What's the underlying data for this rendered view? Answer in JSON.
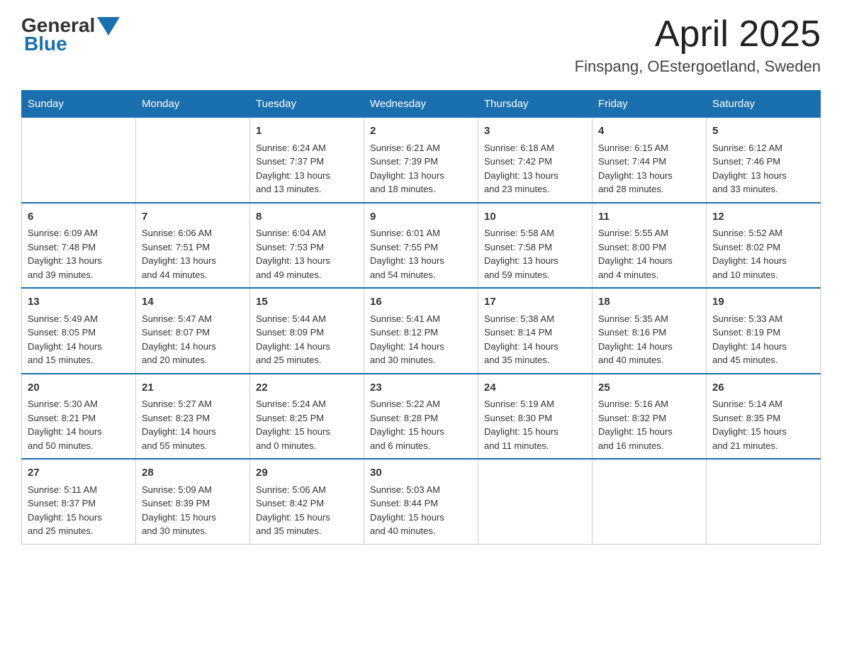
{
  "header": {
    "title": "April 2025",
    "subtitle": "Finspang, OEstergoetland, Sweden",
    "logo_general": "General",
    "logo_blue": "Blue"
  },
  "weekdays": [
    "Sunday",
    "Monday",
    "Tuesday",
    "Wednesday",
    "Thursday",
    "Friday",
    "Saturday"
  ],
  "weeks": [
    [
      {
        "day": "",
        "info": ""
      },
      {
        "day": "",
        "info": ""
      },
      {
        "day": "1",
        "info": "Sunrise: 6:24 AM\nSunset: 7:37 PM\nDaylight: 13 hours\nand 13 minutes."
      },
      {
        "day": "2",
        "info": "Sunrise: 6:21 AM\nSunset: 7:39 PM\nDaylight: 13 hours\nand 18 minutes."
      },
      {
        "day": "3",
        "info": "Sunrise: 6:18 AM\nSunset: 7:42 PM\nDaylight: 13 hours\nand 23 minutes."
      },
      {
        "day": "4",
        "info": "Sunrise: 6:15 AM\nSunset: 7:44 PM\nDaylight: 13 hours\nand 28 minutes."
      },
      {
        "day": "5",
        "info": "Sunrise: 6:12 AM\nSunset: 7:46 PM\nDaylight: 13 hours\nand 33 minutes."
      }
    ],
    [
      {
        "day": "6",
        "info": "Sunrise: 6:09 AM\nSunset: 7:48 PM\nDaylight: 13 hours\nand 39 minutes."
      },
      {
        "day": "7",
        "info": "Sunrise: 6:06 AM\nSunset: 7:51 PM\nDaylight: 13 hours\nand 44 minutes."
      },
      {
        "day": "8",
        "info": "Sunrise: 6:04 AM\nSunset: 7:53 PM\nDaylight: 13 hours\nand 49 minutes."
      },
      {
        "day": "9",
        "info": "Sunrise: 6:01 AM\nSunset: 7:55 PM\nDaylight: 13 hours\nand 54 minutes."
      },
      {
        "day": "10",
        "info": "Sunrise: 5:58 AM\nSunset: 7:58 PM\nDaylight: 13 hours\nand 59 minutes."
      },
      {
        "day": "11",
        "info": "Sunrise: 5:55 AM\nSunset: 8:00 PM\nDaylight: 14 hours\nand 4 minutes."
      },
      {
        "day": "12",
        "info": "Sunrise: 5:52 AM\nSunset: 8:02 PM\nDaylight: 14 hours\nand 10 minutes."
      }
    ],
    [
      {
        "day": "13",
        "info": "Sunrise: 5:49 AM\nSunset: 8:05 PM\nDaylight: 14 hours\nand 15 minutes."
      },
      {
        "day": "14",
        "info": "Sunrise: 5:47 AM\nSunset: 8:07 PM\nDaylight: 14 hours\nand 20 minutes."
      },
      {
        "day": "15",
        "info": "Sunrise: 5:44 AM\nSunset: 8:09 PM\nDaylight: 14 hours\nand 25 minutes."
      },
      {
        "day": "16",
        "info": "Sunrise: 5:41 AM\nSunset: 8:12 PM\nDaylight: 14 hours\nand 30 minutes."
      },
      {
        "day": "17",
        "info": "Sunrise: 5:38 AM\nSunset: 8:14 PM\nDaylight: 14 hours\nand 35 minutes."
      },
      {
        "day": "18",
        "info": "Sunrise: 5:35 AM\nSunset: 8:16 PM\nDaylight: 14 hours\nand 40 minutes."
      },
      {
        "day": "19",
        "info": "Sunrise: 5:33 AM\nSunset: 8:19 PM\nDaylight: 14 hours\nand 45 minutes."
      }
    ],
    [
      {
        "day": "20",
        "info": "Sunrise: 5:30 AM\nSunset: 8:21 PM\nDaylight: 14 hours\nand 50 minutes."
      },
      {
        "day": "21",
        "info": "Sunrise: 5:27 AM\nSunset: 8:23 PM\nDaylight: 14 hours\nand 55 minutes."
      },
      {
        "day": "22",
        "info": "Sunrise: 5:24 AM\nSunset: 8:25 PM\nDaylight: 15 hours\nand 0 minutes."
      },
      {
        "day": "23",
        "info": "Sunrise: 5:22 AM\nSunset: 8:28 PM\nDaylight: 15 hours\nand 6 minutes."
      },
      {
        "day": "24",
        "info": "Sunrise: 5:19 AM\nSunset: 8:30 PM\nDaylight: 15 hours\nand 11 minutes."
      },
      {
        "day": "25",
        "info": "Sunrise: 5:16 AM\nSunset: 8:32 PM\nDaylight: 15 hours\nand 16 minutes."
      },
      {
        "day": "26",
        "info": "Sunrise: 5:14 AM\nSunset: 8:35 PM\nDaylight: 15 hours\nand 21 minutes."
      }
    ],
    [
      {
        "day": "27",
        "info": "Sunrise: 5:11 AM\nSunset: 8:37 PM\nDaylight: 15 hours\nand 25 minutes."
      },
      {
        "day": "28",
        "info": "Sunrise: 5:09 AM\nSunset: 8:39 PM\nDaylight: 15 hours\nand 30 minutes."
      },
      {
        "day": "29",
        "info": "Sunrise: 5:06 AM\nSunset: 8:42 PM\nDaylight: 15 hours\nand 35 minutes."
      },
      {
        "day": "30",
        "info": "Sunrise: 5:03 AM\nSunset: 8:44 PM\nDaylight: 15 hours\nand 40 minutes."
      },
      {
        "day": "",
        "info": ""
      },
      {
        "day": "",
        "info": ""
      },
      {
        "day": "",
        "info": ""
      }
    ]
  ]
}
